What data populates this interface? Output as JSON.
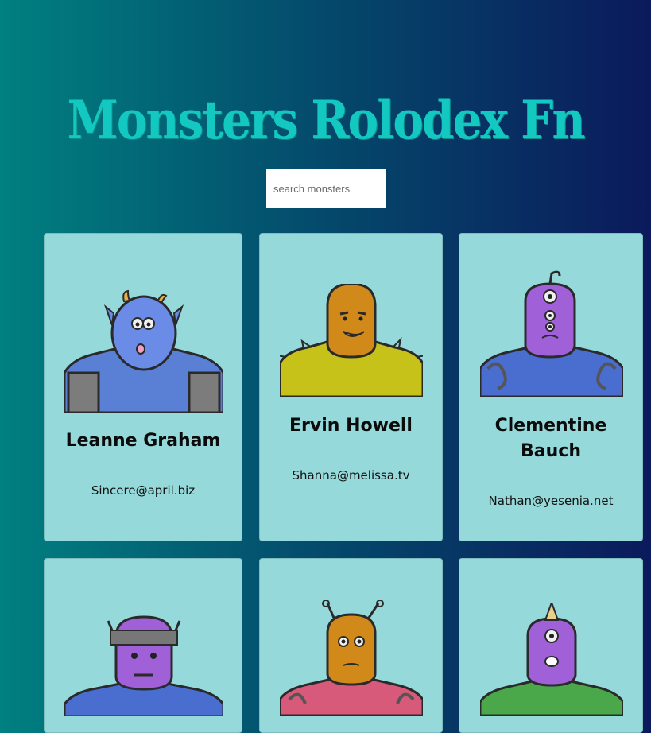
{
  "header": {
    "title": "Monsters Rolodex Fn"
  },
  "search": {
    "placeholder": "search monsters"
  },
  "monsters": [
    {
      "name": "Leanne Graham",
      "email": "Sincere@april.biz"
    },
    {
      "name": "Ervin Howell",
      "email": "Shanna@melissa.tv"
    },
    {
      "name": "Clementine Bauch",
      "email": "Nathan@yesenia.net"
    },
    {
      "name": "",
      "email": ""
    },
    {
      "name": "",
      "email": ""
    },
    {
      "name": "",
      "email": ""
    }
  ],
  "colors": {
    "background_start": "#008080",
    "background_end": "#0b1a5c",
    "title": "#12c8c0",
    "card": "#95d9da"
  }
}
